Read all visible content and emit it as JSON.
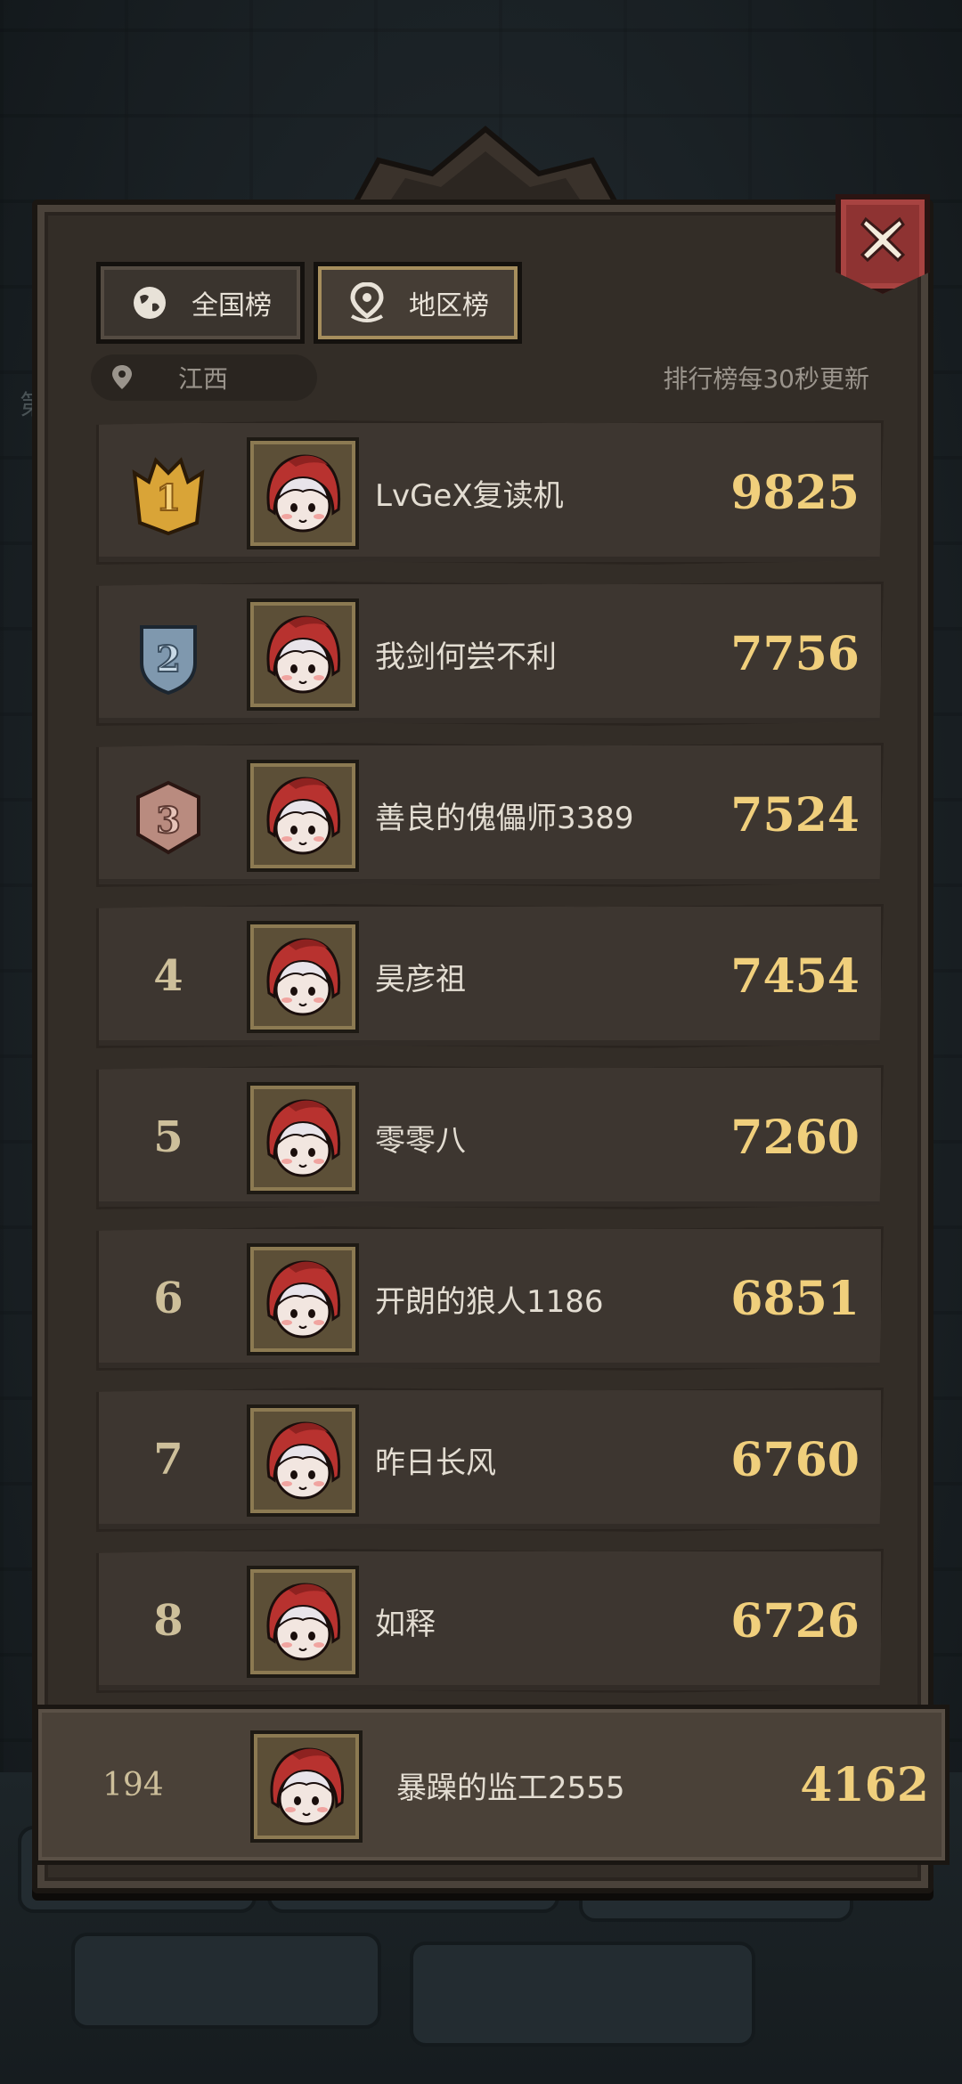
{
  "tabs": [
    {
      "label": "全国榜",
      "icon": "globe-icon",
      "active": false
    },
    {
      "label": "地区榜",
      "icon": "location-pin-icon",
      "active": true
    }
  ],
  "region": {
    "label": "江西",
    "icon": "location-pin-icon"
  },
  "update_note": "排行榜每30秒更新",
  "close_icon": "close-icon",
  "colors": {
    "panel": "#332d27",
    "row": "#3d3630",
    "score": "#f0cf7c",
    "name": "#e3ddd2",
    "close_button": "#8e3332",
    "gold_medal": "#c9952c",
    "silver_medal": "#8aa3b8",
    "bronze_medal": "#b7857a"
  },
  "rows": [
    {
      "rank": "1",
      "medal": "gold",
      "name": "LvGeX复读机",
      "score": "9825"
    },
    {
      "rank": "2",
      "medal": "silver",
      "name": "我剑何尝不利",
      "score": "7756"
    },
    {
      "rank": "3",
      "medal": "bronze",
      "name": "善良的傀儡师3389",
      "score": "7524"
    },
    {
      "rank": "4",
      "medal": null,
      "name": "昊彦祖",
      "score": "7454"
    },
    {
      "rank": "5",
      "medal": null,
      "name": "零零八",
      "score": "7260"
    },
    {
      "rank": "6",
      "medal": null,
      "name": "开朗的狼人1186",
      "score": "6851"
    },
    {
      "rank": "7",
      "medal": null,
      "name": "昨日长风",
      "score": "6760"
    },
    {
      "rank": "8",
      "medal": null,
      "name": "如释",
      "score": "6726"
    }
  ],
  "my_row": {
    "rank": "194",
    "name": "暴躁的监工2555",
    "score": "4162"
  },
  "side_glyph": "第"
}
